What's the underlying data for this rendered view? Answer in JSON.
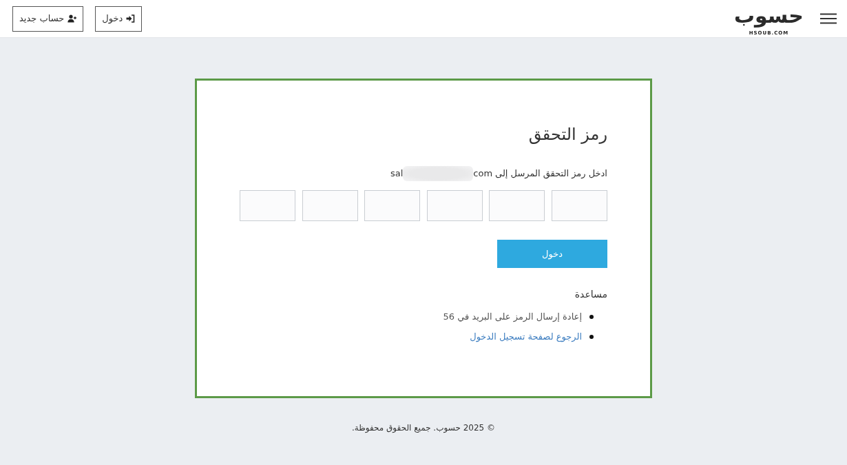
{
  "header": {
    "logo": {
      "wordmark": "حسوب",
      "tagline": "HSOUB.COM"
    },
    "buttons": [
      {
        "kind": "login",
        "label": "دخول"
      },
      {
        "kind": "signup",
        "label": "حساب جديد"
      }
    ]
  },
  "card": {
    "title": "رمز التحقق",
    "prompt": "ادخل رمز التحقق المرسل إلى",
    "email": {
      "start": "sal",
      "end": "com",
      "redacted": true
    },
    "code_fields": [
      {
        "kind": "digit"
      },
      {
        "kind": "digit"
      },
      {
        "kind": "digit"
      },
      {
        "kind": "digit"
      },
      {
        "kind": "digit"
      },
      {
        "kind": "digit"
      }
    ],
    "submit_button": "دخول",
    "help": {
      "title": "مساعدة",
      "items": [
        {
          "kind": "text",
          "text": "إعادة إرسال الرمز على البريد في 56"
        },
        {
          "kind": "link",
          "text": "الرجوع لصفحة تسجيل الدخول"
        }
      ]
    }
  },
  "footer": {
    "text": "© 2025 حسوب. جميع الحقوق محفوظة."
  }
}
